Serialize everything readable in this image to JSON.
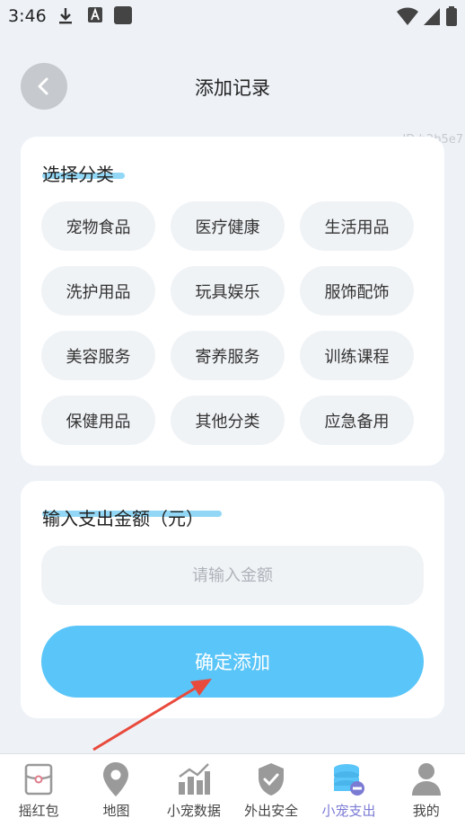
{
  "status_bar": {
    "time": "3:46"
  },
  "header": {
    "title": "添加记录"
  },
  "id_tag": "ID:b2b5e7",
  "category_section": {
    "title": "选择分类",
    "items": [
      "宠物食品",
      "医疗健康",
      "生活用品",
      "洗护用品",
      "玩具娱乐",
      "服饰配饰",
      "美容服务",
      "寄养服务",
      "训练课程",
      "保健用品",
      "其他分类",
      "应急备用"
    ]
  },
  "amount_section": {
    "title": "输入支出金额（元）",
    "placeholder": "请输入金额",
    "value": "",
    "confirm_label": "确定添加"
  },
  "tabbar": {
    "items": [
      {
        "label": "摇红包",
        "icon": "red-packet-icon"
      },
      {
        "label": "地图",
        "icon": "map-pin-icon"
      },
      {
        "label": "小宠数据",
        "icon": "bar-chart-icon"
      },
      {
        "label": "外出安全",
        "icon": "shield-check-icon"
      },
      {
        "label": "小宠支出",
        "icon": "coins-icon"
      },
      {
        "label": "我的",
        "icon": "user-icon"
      }
    ],
    "active_index": 4
  },
  "colors": {
    "accent": "#5ac5f8",
    "active_tab": "#7b7bd4",
    "highlight": "#7fd1f4",
    "annotation_arrow": "#e84a3c"
  }
}
